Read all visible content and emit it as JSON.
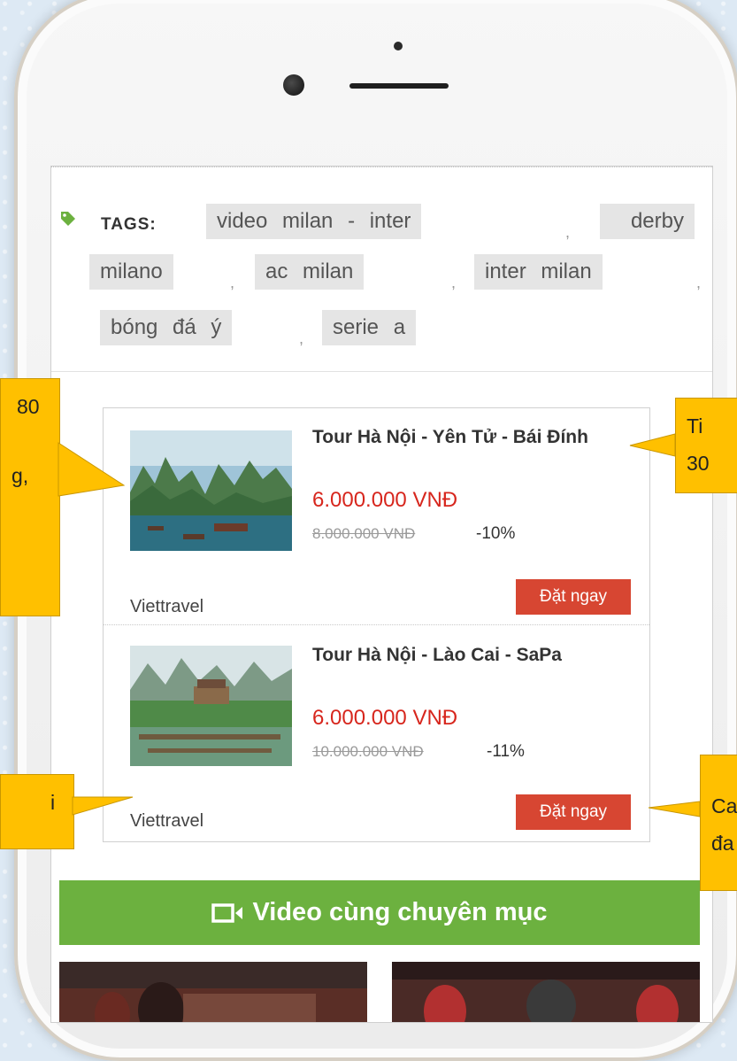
{
  "tags": {
    "label": "TAGS:",
    "items": [
      "video milan - inter",
      "derby milano",
      "ac milan",
      "inter milan",
      "bóng đá ý",
      "serie a"
    ],
    "separator": ","
  },
  "products": [
    {
      "title": "Tour Hà Nội - Yên Tử - Bái Đính",
      "price": "6.000.000 VNĐ",
      "old_price": "8.000.000 VNĐ",
      "discount": "-10%",
      "vendor": "Viettravel",
      "button": "Đặt ngay"
    },
    {
      "title": "Tour Hà Nội - Lào Cai - SaPa",
      "price": "6.000.000 VNĐ",
      "old_price": "10.000.000 VNĐ",
      "discount": "-11%",
      "vendor": "Viettravel",
      "button": "Đặt ngay"
    }
  ],
  "video_section": {
    "title": "Video cùng chuyên mục",
    "icon": "video-camera-icon"
  },
  "callouts": {
    "left_top": "80",
    "left_top_second": "g,",
    "left_bottom": "i",
    "right_top": "Ti",
    "right_top_second": "30",
    "right_bottom": "Ca",
    "right_bottom_second": "đa"
  },
  "colors": {
    "price": "#d7261d",
    "button": "#d74632",
    "video_bar": "#6cb13f",
    "callout": "#ffc000",
    "tag_bg": "#e5e5e5"
  }
}
